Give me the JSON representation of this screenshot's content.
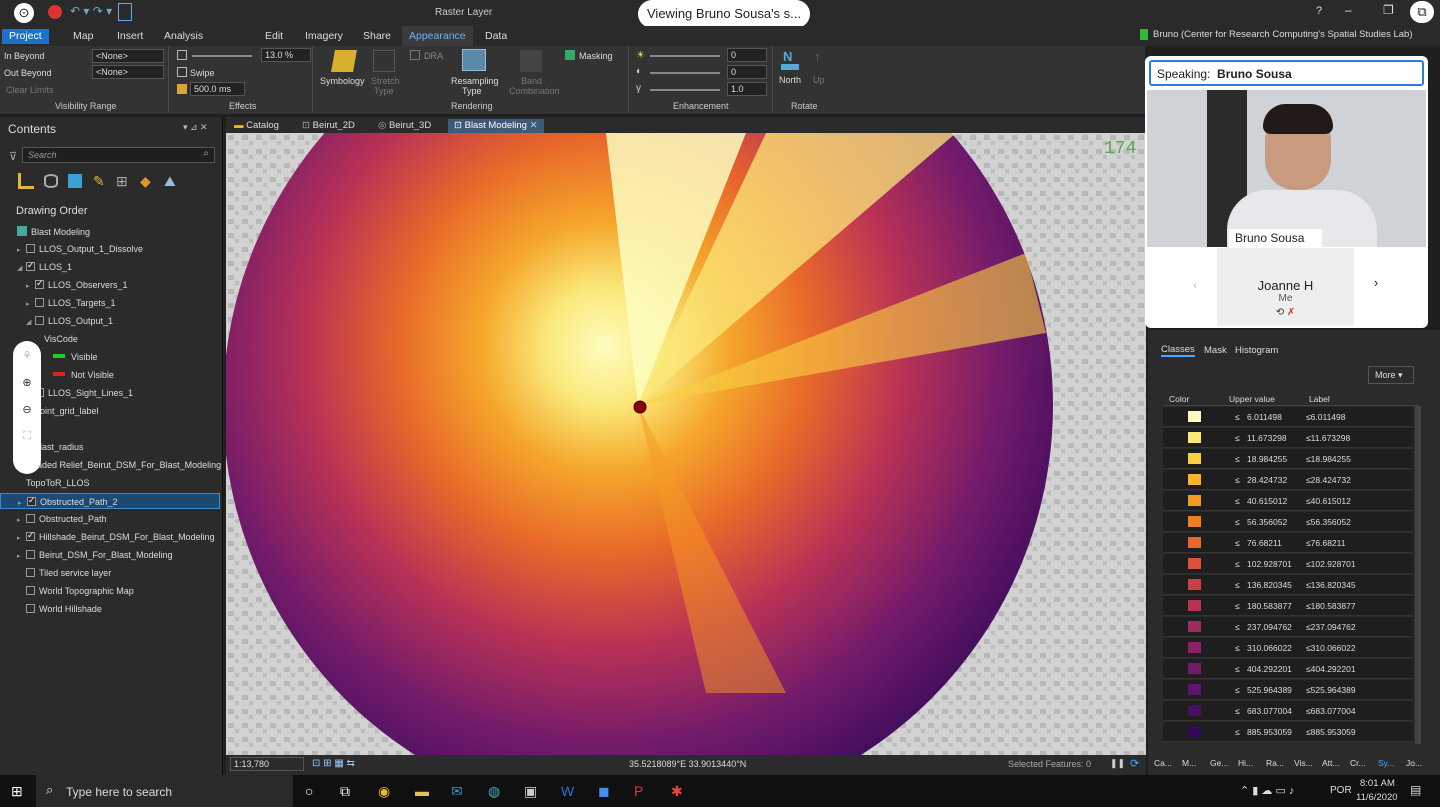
{
  "title_bar": {
    "context_label": "Raster Layer",
    "help": "?",
    "user": "Bruno (Center for Research Computing's Spatial Studies Lab)"
  },
  "notice": "Viewing Bruno Sousa's s...",
  "ribbon_tabs": [
    "Project",
    "Map",
    "Insert",
    "Analysis",
    "Edit",
    "Imagery",
    "Share",
    "Appearance",
    "Data"
  ],
  "ribbon": {
    "in_beyond": "In Beyond",
    "out_beyond": "Out Beyond",
    "none1": "<None>",
    "none2": "<None>",
    "clear_limits": "Clear Limits",
    "visibility_range": "Visibility Range",
    "transparency": "13.0",
    "percent": "%",
    "swipe": "Swipe",
    "flicker": "500.0",
    "ms": "ms",
    "effects": "Effects",
    "symbology": "Symbology",
    "stretch": "Stretch",
    "stretch_type": "Type",
    "dra": "DRA",
    "resampling": "Resampling",
    "resampling_type": "Type",
    "band": "Band",
    "band_comb": "Combination",
    "masking": "Masking",
    "rendering": "Rendering",
    "bright": "0",
    "contrast": "0",
    "gamma": "1.0",
    "enhancement": "Enhancement",
    "north": "North",
    "up": "Up",
    "rotate": "Rotate"
  },
  "contents": {
    "title": "Contents",
    "search_placeholder": "Search",
    "drawing_order": "Drawing Order",
    "layers": [
      {
        "label": "Blast Modeling",
        "indent": 0,
        "cb": "map"
      },
      {
        "label": "LLOS_Output_1_Dissolve",
        "indent": 1,
        "cb": "off",
        "arrow": "▸"
      },
      {
        "label": "LLOS_1",
        "indent": 1,
        "cb": "on",
        "arrow": "◢"
      },
      {
        "label": "LLOS_Observers_1",
        "indent": 2,
        "cb": "on",
        "arrow": "▸"
      },
      {
        "label": "LLOS_Targets_1",
        "indent": 2,
        "cb": "off",
        "arrow": "▸"
      },
      {
        "label": "LLOS_Output_1",
        "indent": 2,
        "cb": "off",
        "arrow": "◢"
      },
      {
        "label": "VisCode",
        "indent": 3,
        "cb": "none"
      },
      {
        "label": "Visible",
        "indent": 4,
        "cb": "green"
      },
      {
        "label": "Not Visible",
        "indent": 4,
        "cb": "red"
      },
      {
        "label": "LLOS_Sight_Lines_1",
        "indent": 2,
        "cb": "off",
        "arrow": "▸"
      },
      {
        "label": "point_grid_label",
        "indent": 2,
        "cb": "none"
      },
      {
        "label": "",
        "indent": 2,
        "cb": "none"
      },
      {
        "label": "blast_radius",
        "indent": 2,
        "cb": "none"
      },
      {
        "label": "Shaded Relief_Beirut_DSM_For_Blast_Modeling",
        "indent": 1,
        "cb": "none"
      },
      {
        "label": "TopoToR_LLOS",
        "indent": 1,
        "cb": "none"
      },
      {
        "label": "Obstructed_Path_2",
        "indent": 1,
        "cb": "on",
        "arrow": "▸",
        "selected": true
      },
      {
        "label": "Obstructed_Path",
        "indent": 1,
        "cb": "off",
        "arrow": "▸"
      },
      {
        "label": "Hillshade_Beirut_DSM_For_Blast_Modeling",
        "indent": 1,
        "cb": "on",
        "arrow": "▸"
      },
      {
        "label": "Beirut_DSM_For_Blast_Modeling",
        "indent": 1,
        "cb": "off",
        "arrow": "▸"
      },
      {
        "label": "Tiled service layer",
        "indent": 1,
        "cb": "off"
      },
      {
        "label": "World Topographic Map",
        "indent": 1,
        "cb": "off"
      },
      {
        "label": "World Hillshade",
        "indent": 1,
        "cb": "off"
      }
    ]
  },
  "view_tabs": [
    "Catalog",
    "Beirut_2D",
    "Beirut_3D",
    "Blast Modeling"
  ],
  "map": {
    "corner_label": "174"
  },
  "status": {
    "scale": "1:13,780",
    "coords": "35.5218089°E 33.9013440°N",
    "selected": "Selected Features: 0"
  },
  "video": {
    "speaking_label": "Speaking:",
    "speaker": "Bruno Sousa",
    "name_tag": "Bruno Sousa",
    "other": "Joanne H",
    "me": "Me"
  },
  "symbology": {
    "tabs": [
      "Classes",
      "Mask",
      "Histogram"
    ],
    "more": "More",
    "headers": [
      "Color",
      "Upper value",
      "Label"
    ],
    "le": "≤",
    "classes": [
      {
        "upper": "6.011498",
        "label": "≤6.011498",
        "color": "#fcfdbf"
      },
      {
        "upper": "11.673298",
        "label": "≤11.673298",
        "color": "#fbe87a"
      },
      {
        "upper": "18.984255",
        "label": "≤18.984255",
        "color": "#f8d043"
      },
      {
        "upper": "28.424732",
        "label": "≤28.424732",
        "color": "#f5b530"
      },
      {
        "upper": "40.615012",
        "label": "≤40.615012",
        "color": "#f59a21"
      },
      {
        "upper": "56.356052",
        "label": "≤56.356052",
        "color": "#f07f1f"
      },
      {
        "upper": "76.68211",
        "label": "≤76.68211",
        "color": "#e8672a"
      },
      {
        "upper": "102.928701",
        "label": "≤102.928701",
        "color": "#dc5239"
      },
      {
        "upper": "136.820345",
        "label": "≤136.820345",
        "color": "#cc3f47"
      },
      {
        "upper": "180.583877",
        "label": "≤180.583877",
        "color": "#b93255"
      },
      {
        "upper": "237.094762",
        "label": "≤237.094762",
        "color": "#a2295e"
      },
      {
        "upper": "310.066022",
        "label": "≤310.066022",
        "color": "#8a2266"
      },
      {
        "upper": "404.292201",
        "label": "≤404.292201",
        "color": "#731b6b"
      },
      {
        "upper": "525.964389",
        "label": "≤525.964389",
        "color": "#5c146c"
      },
      {
        "upper": "683.077004",
        "label": "≤683.077004",
        "color": "#460e66"
      },
      {
        "upper": "885.953059",
        "label": "≤885.953059",
        "color": "#320a55"
      }
    ],
    "bottom_tabs": [
      "Ca...",
      "M...",
      "Ge...",
      "Hi...",
      "Ra...",
      "Vis...",
      "Att...",
      "Cr...",
      "Sy...",
      "Jo..."
    ]
  },
  "taskbar": {
    "search": "Type here to search",
    "lang": "POR",
    "time": "8:01 AM",
    "date": "11/6/2020"
  }
}
